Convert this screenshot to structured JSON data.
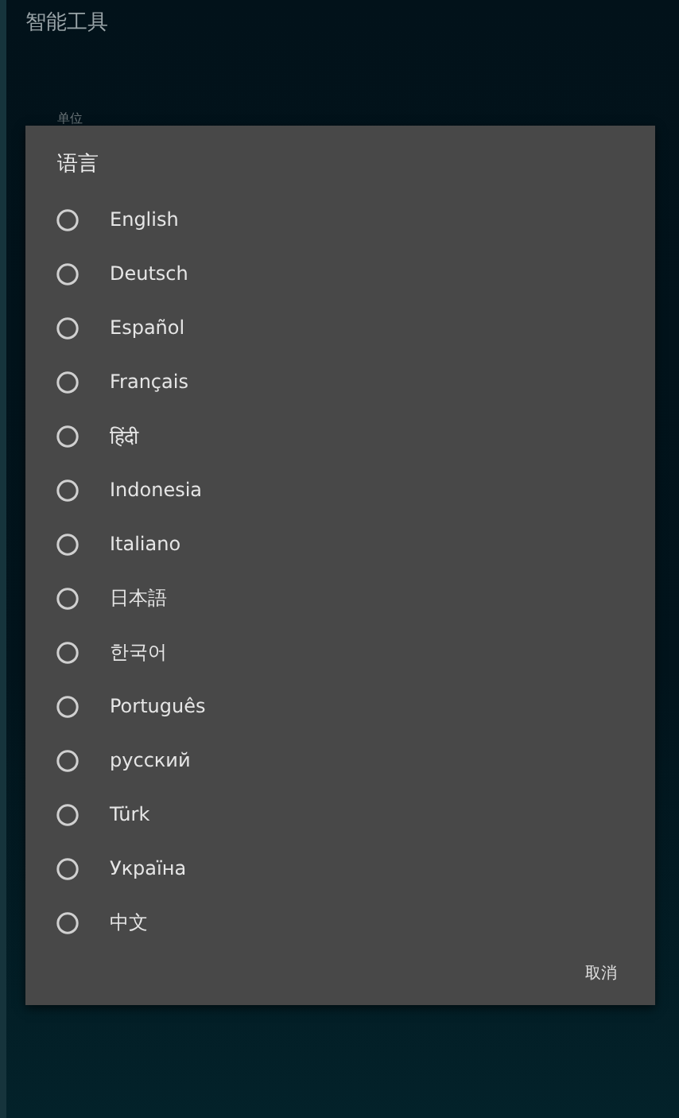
{
  "app_bar": {
    "title": "智能工具"
  },
  "background_label": "单位",
  "dialog": {
    "title": "语言",
    "options": [
      {
        "label": "English",
        "selected": false
      },
      {
        "label": "Deutsch",
        "selected": false
      },
      {
        "label": "Español",
        "selected": false
      },
      {
        "label": "Français",
        "selected": false
      },
      {
        "label": "हिंदी",
        "selected": false
      },
      {
        "label": "Indonesia",
        "selected": false
      },
      {
        "label": "Italiano",
        "selected": false
      },
      {
        "label": "日本語",
        "selected": false
      },
      {
        "label": "한국어",
        "selected": false
      },
      {
        "label": "Português",
        "selected": false
      },
      {
        "label": "русский",
        "selected": false
      },
      {
        "label": "Türk",
        "selected": false
      },
      {
        "label": "Україна",
        "selected": false
      },
      {
        "label": "中文",
        "selected": false
      }
    ],
    "cancel_button": "取消"
  }
}
